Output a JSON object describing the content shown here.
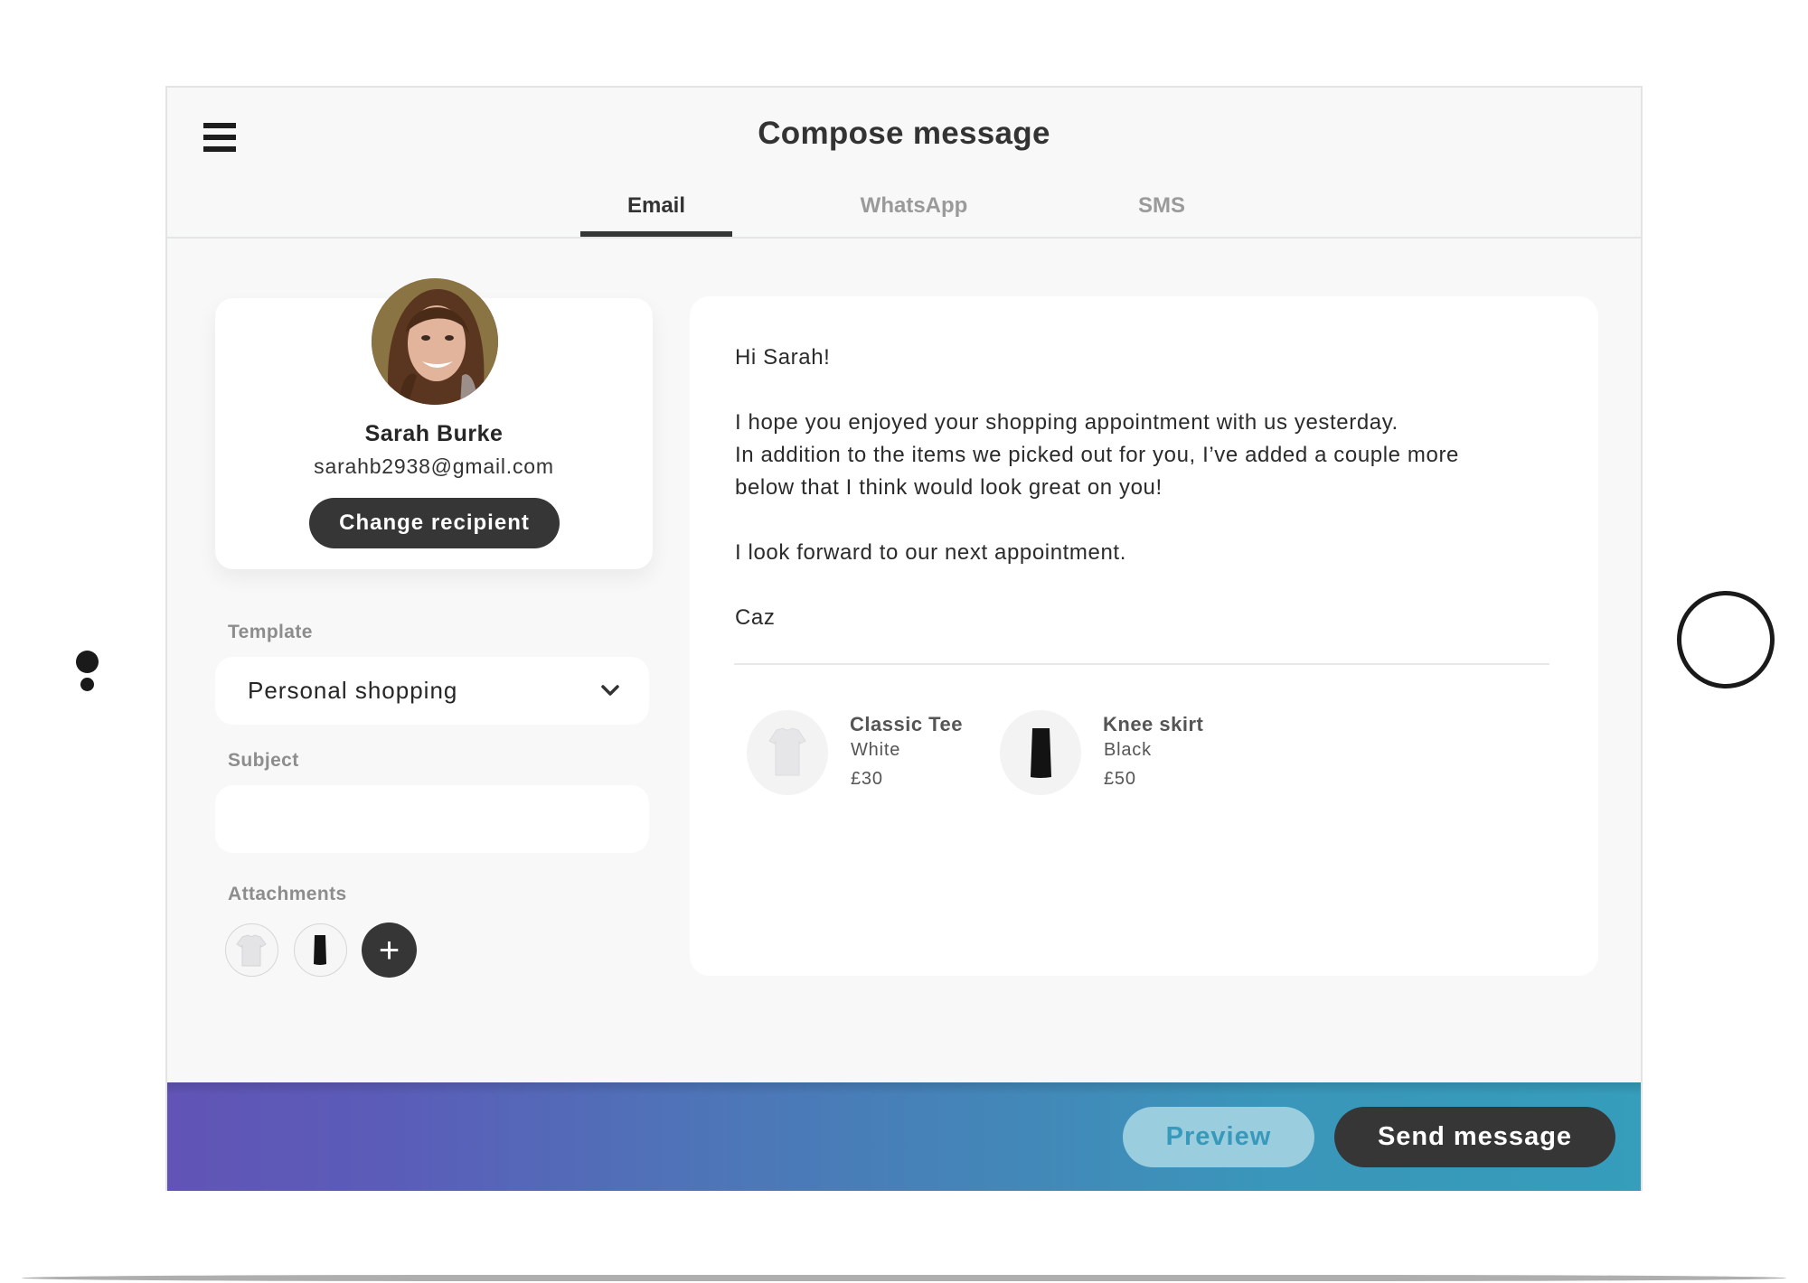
{
  "header": {
    "title": "Compose message",
    "menu_icon": "hamburger-menu-icon"
  },
  "tabs": [
    {
      "label": "Email",
      "active": true
    },
    {
      "label": "WhatsApp",
      "active": false
    },
    {
      "label": "SMS",
      "active": false
    }
  ],
  "recipient": {
    "name": "Sarah Burke",
    "email": "sarahb2938@gmail.com",
    "change_label": "Change recipient"
  },
  "form": {
    "template_label": "Template",
    "template_value": "Personal shopping",
    "subject_label": "Subject",
    "subject_value": "",
    "attachments_label": "Attachments",
    "attachments": [
      {
        "item": "Classic Tee",
        "icon": "tshirt-icon"
      },
      {
        "item": "Knee skirt",
        "icon": "skirt-icon"
      }
    ],
    "add_attachment_symbol": "+"
  },
  "message": {
    "body": "Hi Sarah!\n\nI hope you enjoyed your shopping appointment with us yesterday.\nIn addition to the items we picked out for you, I’ve added a couple more\nbelow that I think would look great on you!\n\nI look forward to our next appointment.\n\nCaz",
    "products": [
      {
        "name": "Classic Tee",
        "color": "White",
        "price": "£30"
      },
      {
        "name": "Knee skirt",
        "color": "Black",
        "price": "£50"
      }
    ]
  },
  "footer": {
    "preview_label": "Preview",
    "send_label": "Send message",
    "gradient_start": "#6154b6",
    "gradient_end": "#369dbb"
  },
  "device": {
    "left_icon": "camera-dots-icon",
    "right_icon": "home-button-icon"
  }
}
